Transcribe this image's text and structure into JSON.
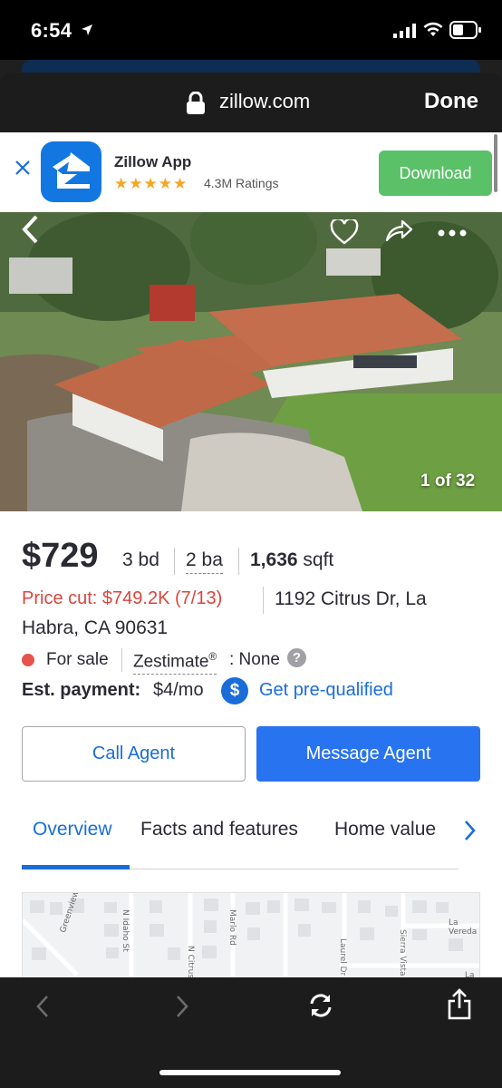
{
  "status_bar": {
    "time": "6:54"
  },
  "browser": {
    "url": "zillow.com",
    "done_label": "Done",
    "toolbar_icons": [
      "back-icon",
      "forward-icon",
      "refresh-icon",
      "share-icon"
    ]
  },
  "app_banner": {
    "name": "Zillow App",
    "stars": "★★★★★",
    "ratings": "4.3M Ratings",
    "download_label": "Download"
  },
  "photo": {
    "counter": "1 of 32",
    "icons": [
      "back-chevron-icon",
      "heart-icon",
      "share-icon",
      "more-icon"
    ]
  },
  "listing": {
    "price": "$729",
    "beds": "3 bd",
    "baths": "2 ba",
    "sqft_value": "1,636",
    "sqft_unit": "sqft",
    "price_cut": "Price cut: $749.2K (7/13)",
    "address_line1": "1192 Citrus Dr, La",
    "address_line2": "Habra, CA 90631",
    "status": "For sale",
    "zestimate_label": "Zestimate",
    "zestimate_reg": "®",
    "zestimate_value": ": None",
    "help": "?",
    "est_payment_label": "Est. payment:",
    "est_payment_value": "$4/mo",
    "dollar_symbol": "$",
    "prequal_link": "Get pre-qualified"
  },
  "actions": {
    "call_agent": "Call Agent",
    "message_agent": "Message Agent"
  },
  "tabs": [
    {
      "label": "Overview",
      "active": true
    },
    {
      "label": "Facts and features",
      "active": false
    },
    {
      "label": "Home value",
      "active": false
    }
  ],
  "map": {
    "streets": [
      "N Idaho St",
      "Greenview Dr",
      "Marlo Rd",
      "N Citrus Dr",
      "Laurel Dr",
      "Sierra Vista Dr",
      "La Vereda",
      "La S"
    ]
  },
  "colors": {
    "accent": "#1a6dd9",
    "primary_button": "#2873f0",
    "price_cut": "#d9463c",
    "download": "#5ac168",
    "status_dot": "#e5534b"
  }
}
